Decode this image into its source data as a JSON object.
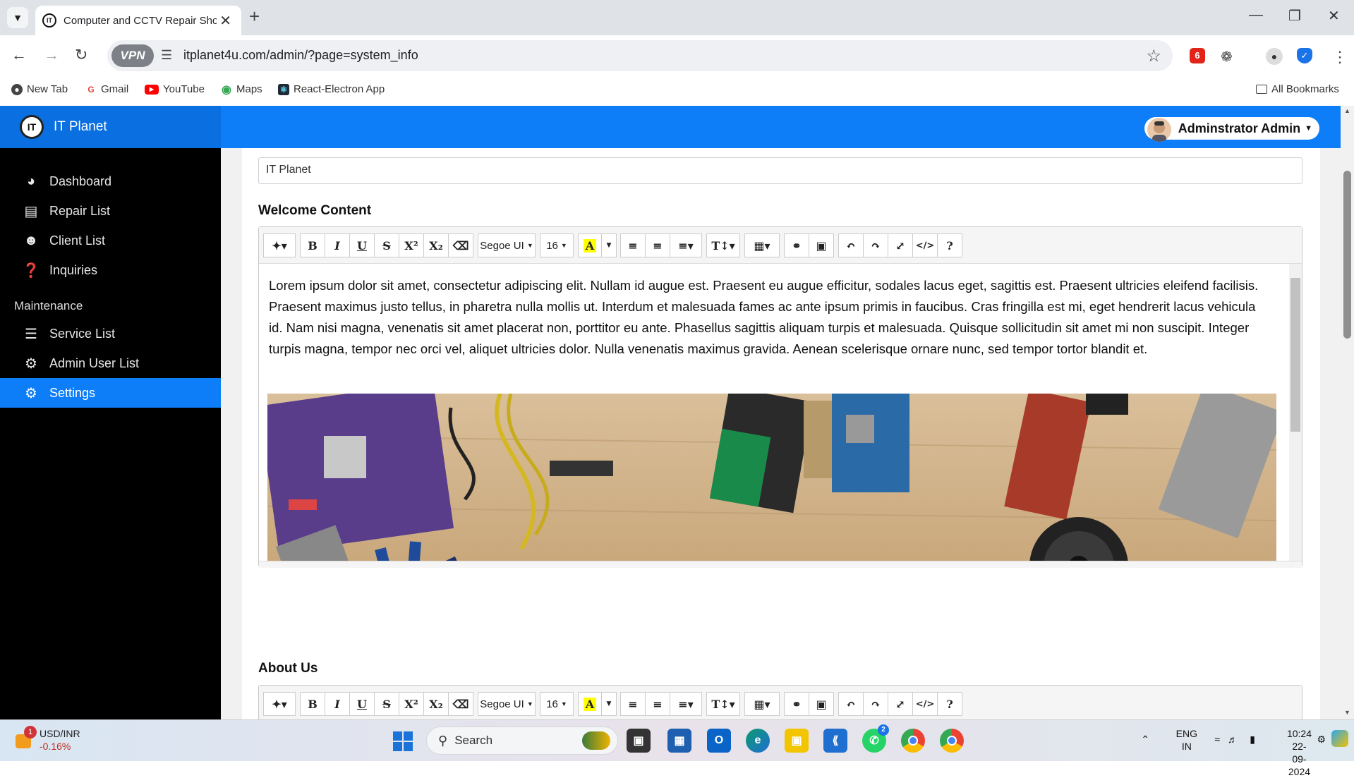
{
  "browser": {
    "tab_title": "Computer and CCTV Repair Sho",
    "url": "itplanet4u.com/admin/?page=system_info",
    "vpn_label": "VPN",
    "bookmarks": [
      "New Tab",
      "Gmail",
      "YouTube",
      "Maps",
      "React-Electron App"
    ],
    "all_bookmarks": "All Bookmarks"
  },
  "app": {
    "brand": "IT Planet",
    "brand_logo": "IT",
    "user": "Adminstrator Admin",
    "accent": "#0d7ef7"
  },
  "sidebar": {
    "items": [
      {
        "label": "Dashboard",
        "icon": "tachometer-icon"
      },
      {
        "label": "Repair List",
        "icon": "file-list-icon"
      },
      {
        "label": "Client List",
        "icon": "users-icon"
      },
      {
        "label": "Inquiries",
        "icon": "question-icon"
      }
    ],
    "section": "Maintenance",
    "maint_items": [
      {
        "label": "Service List",
        "icon": "list-icon"
      },
      {
        "label": "Admin User List",
        "icon": "users-cog-icon"
      },
      {
        "label": "Settings",
        "icon": "cogs-icon",
        "active": true
      }
    ]
  },
  "form": {
    "system_name_value": "IT Planet",
    "welcome_title": "Welcome Content",
    "welcome_body": "Lorem ipsum dolor sit amet, consectetur adipiscing elit. Nullam id augue est. Praesent eu augue efficitur, sodales lacus eget, sagittis est. Praesent ultricies eleifend facilisis. Praesent maximus justo tellus, in pharetra nulla mollis ut. Interdum et malesuada fames ac ante ipsum primis in faucibus. Cras fringilla est mi, eget hendrerit lacus vehicula id. Nam nisi magna, venenatis sit amet placerat non, porttitor eu ante. Phasellus sagittis aliquam turpis et malesuada. Quisque sollicitudin sit amet mi non suscipit. Integer turpis magna, tempor nec orci vel, aliquet ultricies dolor. Nulla venenatis maximus gravida. Aenean scelerisque ornare nunc, sed tempor tortor blandit et.",
    "about_title": "About Us"
  },
  "toolbar": {
    "font_name": "Segoe UI",
    "font_size": "16",
    "bold": "B",
    "italic": "I",
    "underline": "U",
    "strike": "S",
    "help": "?"
  },
  "taskbar": {
    "stock_name": "USD/INR",
    "stock_change": "-0.16%",
    "stock_badge": "1",
    "search_placeholder": "Search",
    "whatsapp_badge": "2",
    "lang1": "ENG",
    "lang2": "IN",
    "time": "10:24",
    "date": "22-09-2024"
  }
}
